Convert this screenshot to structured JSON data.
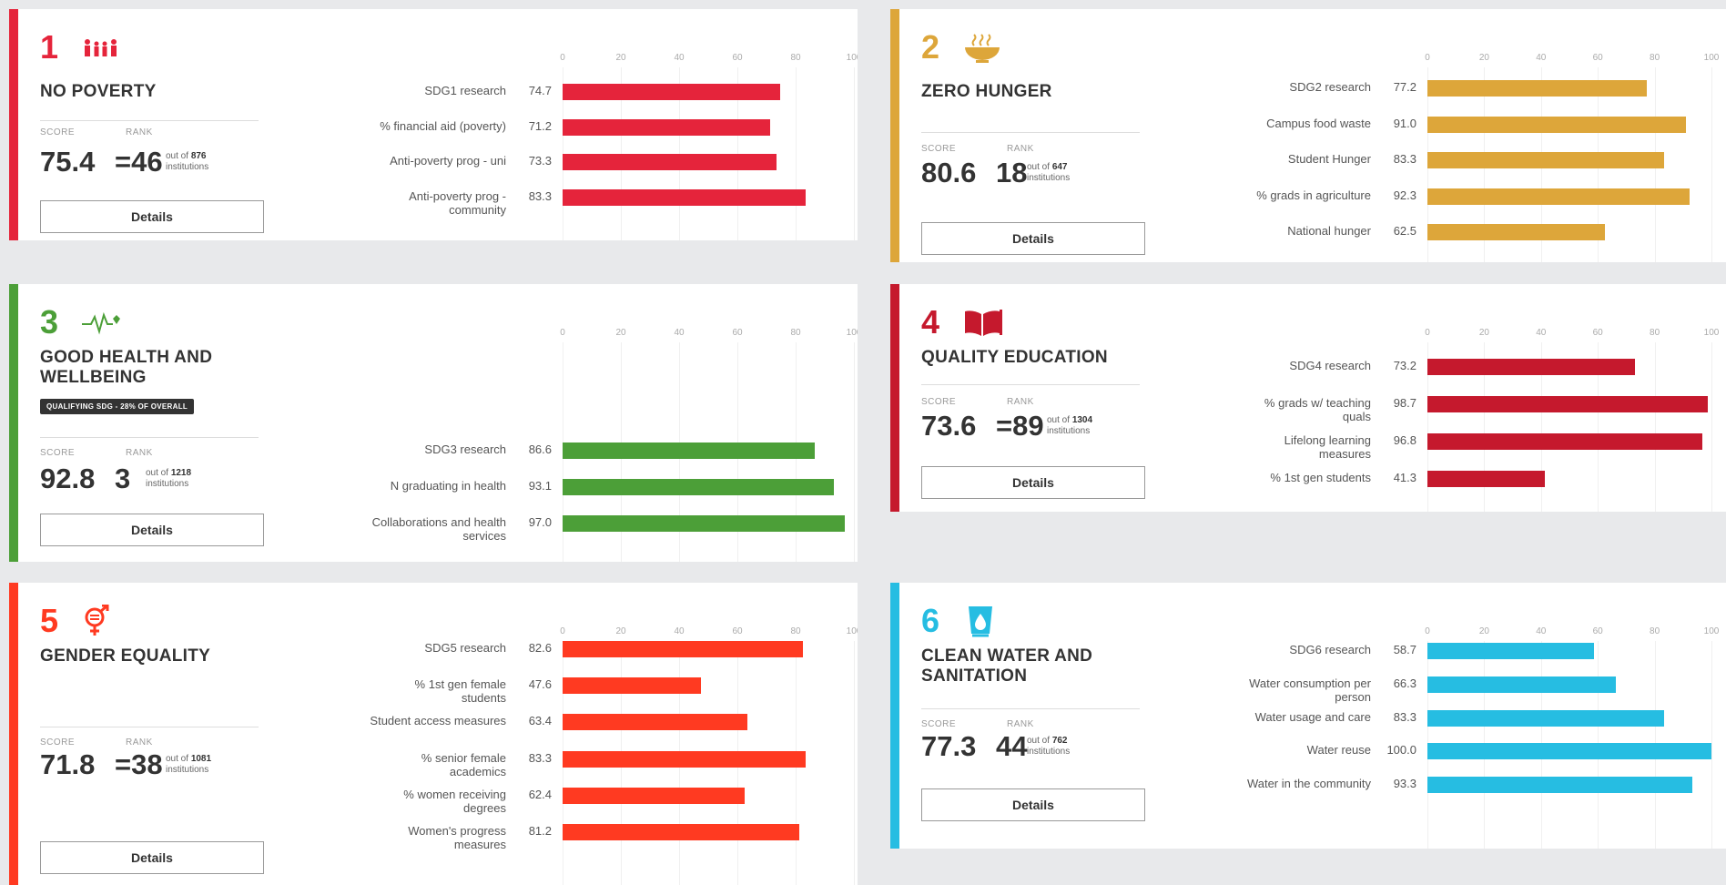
{
  "axis_ticks": [
    "0",
    "20",
    "40",
    "60",
    "80",
    "100"
  ],
  "cards": [
    {
      "number": "1",
      "title": "NO POVERTY",
      "color": "#e5243b",
      "icon": "family-icon",
      "score_label": "SCORE",
      "score": "75.4",
      "rank_label": "RANK",
      "rank": "=46",
      "out_of_prefix": "out of",
      "out_of": "876",
      "out_of_suffix": "institutions",
      "details": "Details",
      "metrics": [
        {
          "label": "SDG1 research",
          "score": "74.7",
          "value": 74.7
        },
        {
          "label": "% financial aid (poverty)",
          "score": "71.2",
          "value": 71.2
        },
        {
          "label": "Anti-poverty prog - uni",
          "score": "73.3",
          "value": 73.3
        },
        {
          "label": "Anti-poverty prog - community",
          "score": "83.3",
          "value": 83.3
        }
      ]
    },
    {
      "number": "2",
      "title": "ZERO HUNGER",
      "color": "#dda63a",
      "icon": "food-bowl-icon",
      "score_label": "SCORE",
      "score": "80.6",
      "rank_label": "RANK",
      "rank": "18",
      "out_of_prefix": "out of",
      "out_of": "647",
      "out_of_suffix": "institutions",
      "details": "Details",
      "metrics": [
        {
          "label": "SDG2 research",
          "score": "77.2",
          "value": 77.2
        },
        {
          "label": "Campus food waste",
          "score": "91.0",
          "value": 91.0
        },
        {
          "label": "Student Hunger",
          "score": "83.3",
          "value": 83.3
        },
        {
          "label": "% grads in agriculture",
          "score": "92.3",
          "value": 92.3
        },
        {
          "label": "National hunger",
          "score": "62.5",
          "value": 62.5
        }
      ]
    },
    {
      "number": "3",
      "title": "GOOD HEALTH AND WELLBEING",
      "color": "#4c9f38",
      "icon": "heartbeat-icon",
      "badge": "QUALIFYING SDG - 28% OF OVERALL",
      "score_label": "SCORE",
      "score": "92.8",
      "rank_label": "RANK",
      "rank": "3",
      "out_of_prefix": "out of",
      "out_of": "1218",
      "out_of_suffix": "institutions",
      "details": "Details",
      "metrics": [
        {
          "label": "SDG3 research",
          "score": "86.6",
          "value": 86.6
        },
        {
          "label": "N graduating in health",
          "score": "93.1",
          "value": 93.1
        },
        {
          "label": "Collaborations and health services",
          "score": "97.0",
          "value": 97.0
        }
      ]
    },
    {
      "number": "4",
      "title": "QUALITY EDUCATION",
      "color": "#c5192d",
      "icon": "book-icon",
      "score_label": "SCORE",
      "score": "73.6",
      "rank_label": "RANK",
      "rank": "=89",
      "out_of_prefix": "out of",
      "out_of": "1304",
      "out_of_suffix": "institutions",
      "details": "Details",
      "metrics": [
        {
          "label": "SDG4 research",
          "score": "73.2",
          "value": 73.2
        },
        {
          "label": "% grads w/ teaching quals",
          "score": "98.7",
          "value": 98.7
        },
        {
          "label": "Lifelong learning measures",
          "score": "96.8",
          "value": 96.8
        },
        {
          "label": "% 1st gen students",
          "score": "41.3",
          "value": 41.3
        }
      ]
    },
    {
      "number": "5",
      "title": "GENDER EQUALITY",
      "color": "#ff3a21",
      "icon": "gender-icon",
      "score_label": "SCORE",
      "score": "71.8",
      "rank_label": "RANK",
      "rank": "=38",
      "out_of_prefix": "out of",
      "out_of": "1081",
      "out_of_suffix": "institutions",
      "details": "Details",
      "metrics": [
        {
          "label": "SDG5 research",
          "score": "82.6",
          "value": 82.6
        },
        {
          "label": "% 1st gen female students",
          "score": "47.6",
          "value": 47.6
        },
        {
          "label": "Student access measures",
          "score": "63.4",
          "value": 63.4
        },
        {
          "label": "% senior female academics",
          "score": "83.3",
          "value": 83.3
        },
        {
          "label": "% women receiving degrees",
          "score": "62.4",
          "value": 62.4
        },
        {
          "label": "Women's progress measures",
          "score": "81.2",
          "value": 81.2
        }
      ]
    },
    {
      "number": "6",
      "title": "CLEAN WATER AND SANITATION",
      "color": "#26bde2",
      "icon": "water-drop-glass-icon",
      "score_label": "SCORE",
      "score": "77.3",
      "rank_label": "RANK",
      "rank": "44",
      "out_of_prefix": "out of",
      "out_of": "762",
      "out_of_suffix": "institutions",
      "details": "Details",
      "metrics": [
        {
          "label": "SDG6 research",
          "score": "58.7",
          "value": 58.7
        },
        {
          "label": "Water consumption per person",
          "score": "66.3",
          "value": 66.3
        },
        {
          "label": "Water usage and care",
          "score": "83.3",
          "value": 83.3
        },
        {
          "label": "Water reuse",
          "score": "100.0",
          "value": 100.0
        },
        {
          "label": "Water in the community",
          "score": "93.3",
          "value": 93.3
        }
      ]
    }
  ]
}
